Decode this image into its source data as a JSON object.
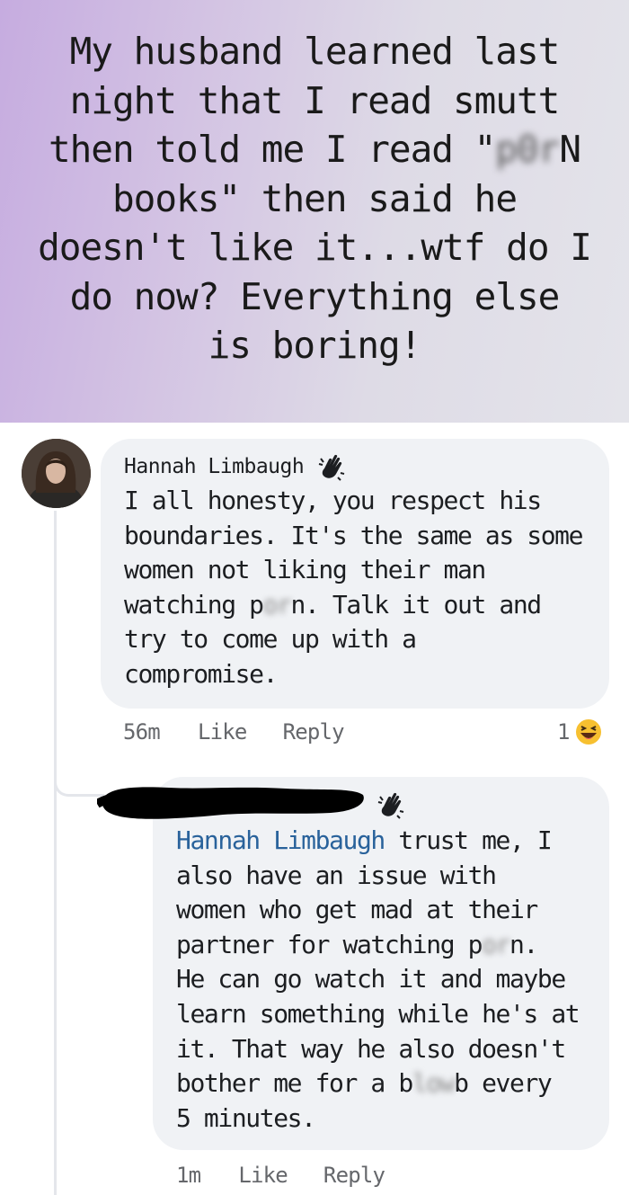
{
  "post": {
    "line1": "My husband learned last",
    "line2": "night that I read smutt",
    "line3_pre": "then told me I read \"",
    "line3_blur": "p0r",
    "line3_post": "N",
    "line4": "books\" then said he",
    "line5": "doesn't like it...wtf do I",
    "line6": "do now? Everything else",
    "line7": "is boring!"
  },
  "comment1": {
    "author": "Hannah Limbaugh",
    "text_a": "I all honesty, you respect his\nboundaries. It's the same as some\nwomen not liking their man\nwatching p",
    "text_blur": "or",
    "text_b": "n. Talk it out and\ntry to come up with a\ncompromise.",
    "time": "56m",
    "like": "Like",
    "reply": "Reply",
    "reaction_count": "1"
  },
  "comment2": {
    "mention": "Hannah Limbaugh",
    "text_a": " trust me, I\nalso have an issue with\nwomen who get mad at their\npartner for watching p",
    "text_blur1": "or",
    "text_b": "n.\nHe can go watch it and maybe\nlearn something while he's at\nit. That way he also doesn't\nbother me for a b",
    "text_blur2": "low",
    "text_c": "b every\n5 minutes.",
    "time": "1m",
    "like": "Like",
    "reply": "Reply"
  },
  "colors": {
    "mention": "#29629b",
    "bubble": "#f0f2f5",
    "meta": "#65676b"
  }
}
